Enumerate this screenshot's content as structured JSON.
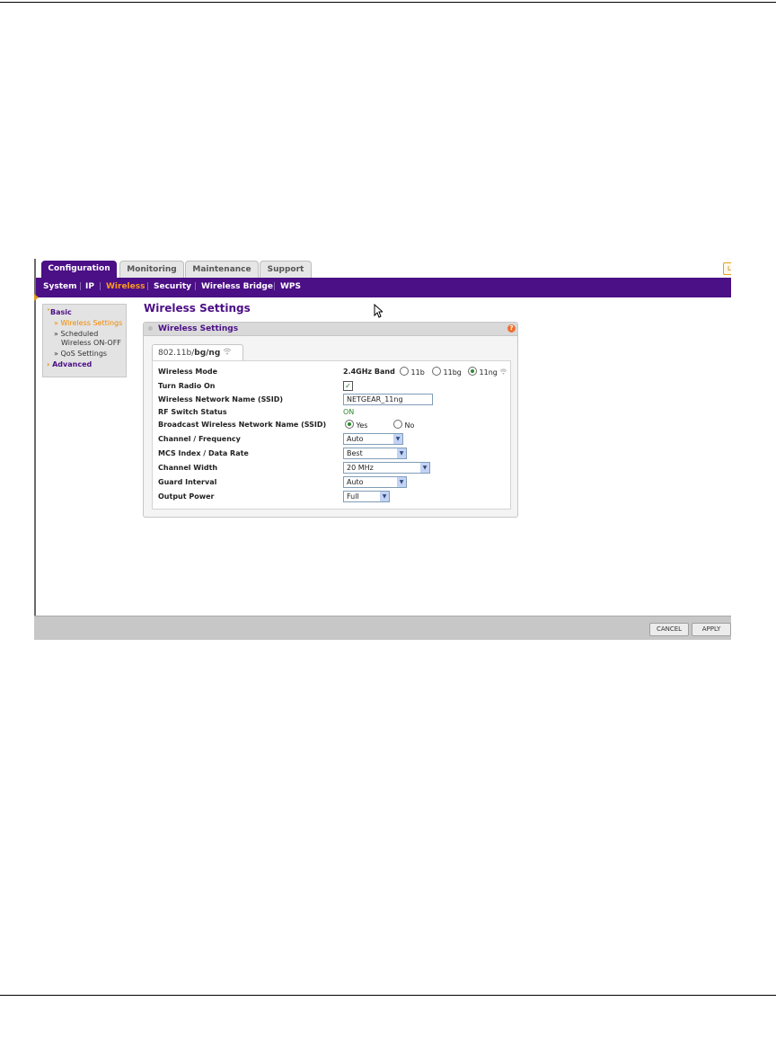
{
  "tabs": [
    {
      "label": "Configuration",
      "active": true
    },
    {
      "label": "Monitoring",
      "active": false
    },
    {
      "label": "Maintenance",
      "active": false
    },
    {
      "label": "Support",
      "active": false
    }
  ],
  "subnav": [
    "System",
    "IP",
    "Wireless",
    "Security",
    "Wireless Bridge",
    "WPS"
  ],
  "subnav_active": "Wireless",
  "leftmenu": {
    "basic": "Basic",
    "items": [
      "Wireless Settings",
      "Scheduled",
      "Wireless ON-OFF",
      "QoS Settings"
    ],
    "advanced": "Advanced"
  },
  "page_title": "Wireless Settings",
  "panel": {
    "title": "Wireless Settings",
    "help": "?",
    "mode_tab": {
      "prefix": "802.11b/",
      "bold": "bg/ng"
    }
  },
  "form": {
    "wireless_mode": {
      "label": "Wireless Mode",
      "band": "2.4GHz Band",
      "options": [
        "11b",
        "11bg",
        "11ng"
      ],
      "selected": "11ng"
    },
    "radio_on": {
      "label": "Turn Radio On",
      "checked": true
    },
    "ssid": {
      "label": "Wireless Network Name (SSID)",
      "value": "NETGEAR_11ng"
    },
    "rf_switch": {
      "label": "RF Switch Status",
      "value": "ON"
    },
    "broadcast": {
      "label": "Broadcast Wireless Network Name (SSID)",
      "yes": "Yes",
      "no": "No",
      "selected": "Yes"
    },
    "channel": {
      "label": "Channel / Frequency",
      "value": "Auto"
    },
    "mcs": {
      "label": "MCS Index / Data Rate",
      "value": "Best"
    },
    "width": {
      "label": "Channel Width",
      "value": "20 MHz"
    },
    "guard": {
      "label": "Guard Interval",
      "value": "Auto"
    },
    "power": {
      "label": "Output Power",
      "value": "Full"
    }
  },
  "buttons": {
    "cancel": "CANCEL",
    "apply": "APPLY"
  },
  "icons": {
    "help": "help-icon",
    "dropdown": "chevron-down-icon",
    "wifi": "wifi-icon",
    "cursor": "cursor-icon"
  },
  "colors": {
    "brand_purple": "#4b0f86",
    "active_orange": "#ff9a1f",
    "ok_green": "#2c8a2c"
  }
}
